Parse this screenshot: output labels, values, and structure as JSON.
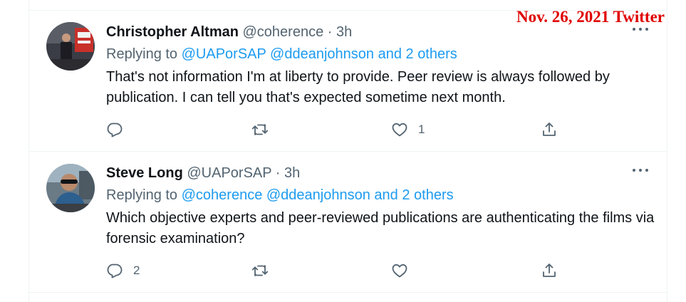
{
  "stamp": {
    "text": "Nov. 26, 2021 Twitter",
    "color": "#e00000"
  },
  "colors": {
    "name": "#0f1419",
    "muted": "#536471",
    "link": "#1d9bf0",
    "divider": "#eff3f4"
  },
  "tweets": [
    {
      "author_name": "Christopher Altman",
      "author_handle": "@coherence",
      "separator": "·",
      "time": "3h",
      "replying_prefix": "Replying to",
      "replying_mentions": "@UAPorSAP @ddeanjohnson and 2 others",
      "text": "That's not information I'm at liberty to provide. Peer review is always followed by publication. I can tell you that's expected sometime next month.",
      "reply_count": "",
      "retweet_count": "",
      "like_count": "1",
      "avatar_icon": "avatar-photo-presenter"
    },
    {
      "author_name": "Steve Long",
      "author_handle": "@UAPorSAP",
      "separator": "·",
      "time": "3h",
      "replying_prefix": "Replying to",
      "replying_mentions": "@coherence @ddeanjohnson and 2 others",
      "text": "Which objective experts and peer-reviewed publications are authenticating the films via forensic examination?",
      "reply_count": "2",
      "retweet_count": "",
      "like_count": "",
      "avatar_icon": "avatar-photo-sunglasses"
    }
  ],
  "icons": {
    "reply": "reply-bubble-icon",
    "retweet": "retweet-icon",
    "like": "heart-icon",
    "share": "share-icon",
    "more": "more-dots-icon"
  }
}
